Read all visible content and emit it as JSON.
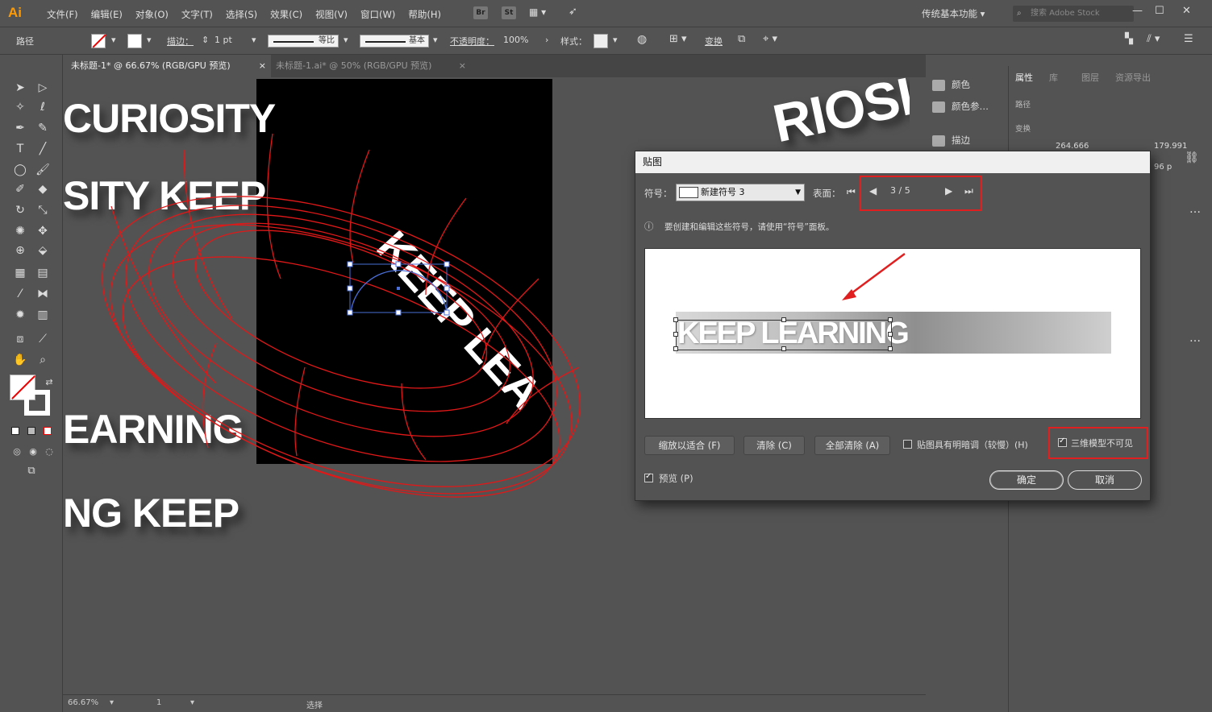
{
  "app": {
    "logo": "Ai",
    "menus": [
      "文件(F)",
      "编辑(E)",
      "对象(O)",
      "文字(T)",
      "选择(S)",
      "效果(C)",
      "视图(V)",
      "窗口(W)",
      "帮助(H)"
    ],
    "ext_br": "Br",
    "ext_st": "St",
    "workspace": "传统基本功能",
    "search_placeholder": "搜索 Adobe Stock"
  },
  "control_bar": {
    "object_type": "路径",
    "stroke_label": "描边：",
    "stroke_value": "1 pt",
    "profile_label": "等比",
    "brush_label": "基本",
    "opacity_label": "不透明度：",
    "opacity_value": "100%",
    "style_label": "样式：",
    "transform_label": "变换"
  },
  "tabs": [
    {
      "label": "未标题-1* @ 66.67% (RGB/GPU 预览)"
    },
    {
      "label": "未标题-1.ai* @ 50% (RGB/GPU 预览)"
    }
  ],
  "canvas": {
    "texts": [
      "CURIOSITY",
      "SITY KEEP",
      "EARNING",
      "NG KEEP",
      "KEEP LEA",
      "RIOSI"
    ]
  },
  "status_bar": {
    "zoom": "66.67%",
    "artboard": "1",
    "tool": "选择"
  },
  "side_panels": {
    "color": "颜色",
    "color_guide": "颜色参…",
    "stroke": "描边"
  },
  "properties_panel": {
    "tabs": [
      "属性",
      "库",
      "图层",
      "资源导出"
    ],
    "path_label": "路径",
    "transform_label": "变换",
    "x_value": "264.666",
    "y_value": "179.991",
    "w_value": "96 p"
  },
  "dialog": {
    "title": "贴图",
    "symbol_label": "符号：",
    "symbol_value": "新建符号 3",
    "surface_label": "表面：",
    "surface_current": "3",
    "surface_total": "5",
    "info_text": "要创建和编辑这些符号，请使用“符号”面板。",
    "preview_text": "KEEP LEARNING",
    "btn_fit": "缩放以适合 (F)",
    "btn_clear": "清除 (C)",
    "btn_clear_all": "全部清除 (A)",
    "shade_label": "贴图具有明暗调（较慢）(H)",
    "invisible_label": "三维模型不可见",
    "preview_label": "预览 (P)",
    "ok_label": "确定",
    "cancel_label": "取消",
    "accent_red": "#e02020"
  }
}
